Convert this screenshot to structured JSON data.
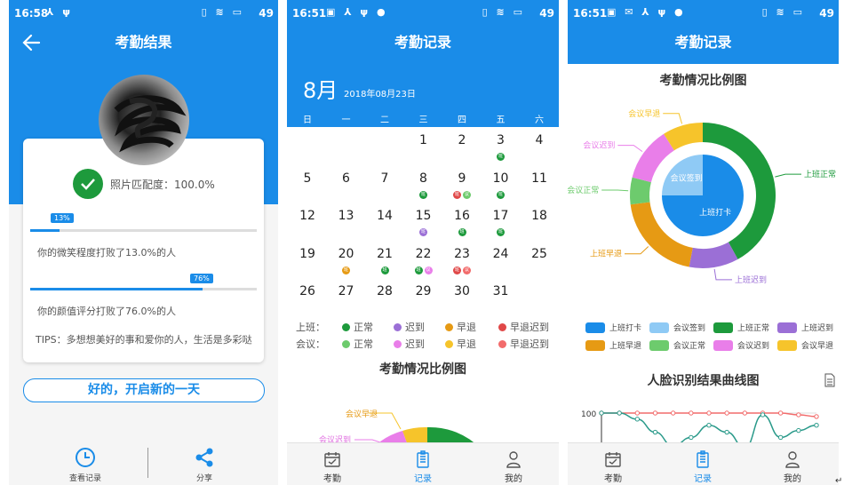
{
  "colors": {
    "primary": "#1a8ce8",
    "green": "#1d9a3c",
    "purple": "#9b6fd6",
    "orange": "#e69a14",
    "red": "#e04848",
    "light_green": "#6dcb6d",
    "pink": "#e97ee9",
    "yellow": "#f6c42b",
    "light_red": "#f26b6b",
    "light_blue": "#8fcaf5"
  },
  "screen1": {
    "status": {
      "time": "16:58",
      "battery": "49"
    },
    "title": "考勤结果",
    "match_text": "照片匹配度：100.0%",
    "smile": {
      "badge": "13%",
      "percent": 13,
      "text": "你的微笑程度打败了13.0%的人"
    },
    "looks": {
      "badge": "76%",
      "percent": 76,
      "text": "你的颜值评分打败了76.0%的人"
    },
    "tips": "TIPS：多想想美好的事和爱你的人，生活是多彩哒",
    "ok_button": "好的，开启新的一天",
    "actions": {
      "records": "查看记录",
      "share": "分享"
    }
  },
  "screen2": {
    "status": {
      "time": "16:51",
      "battery": "49"
    },
    "title": "考勤记录",
    "month": "8月",
    "date": "2018年08月23日",
    "weekdays": [
      "日",
      "一",
      "二",
      "三",
      "四",
      "五",
      "六"
    ],
    "days": [
      "1",
      "2",
      "3",
      "4",
      "5",
      "6",
      "7",
      "8",
      "9",
      "10",
      "11",
      "12",
      "13",
      "14",
      "15",
      "16",
      "17",
      "18",
      "19",
      "20",
      "21",
      "22",
      "23",
      "24",
      "25",
      "26",
      "27",
      "28",
      "29",
      "30",
      "31"
    ],
    "tags": [
      {
        "day": 3,
        "items": [
          {
            "label": "班",
            "color": "green"
          }
        ]
      },
      {
        "day": 8,
        "items": [
          {
            "label": "班",
            "color": "green"
          }
        ]
      },
      {
        "day": 9,
        "items": [
          {
            "label": "班",
            "color": "red"
          },
          {
            "label": "议",
            "color": "light_green"
          }
        ]
      },
      {
        "day": 10,
        "items": [
          {
            "label": "班",
            "color": "green"
          }
        ]
      },
      {
        "day": 15,
        "items": [
          {
            "label": "班",
            "color": "purple"
          }
        ]
      },
      {
        "day": 16,
        "items": [
          {
            "label": "班",
            "color": "green"
          }
        ]
      },
      {
        "day": 17,
        "items": [
          {
            "label": "班",
            "color": "green"
          }
        ]
      },
      {
        "day": 20,
        "items": [
          {
            "label": "班",
            "color": "orange"
          }
        ]
      },
      {
        "day": 21,
        "items": [
          {
            "label": "班",
            "color": "green"
          }
        ]
      },
      {
        "day": 22,
        "items": [
          {
            "label": "班",
            "color": "green"
          },
          {
            "label": "议",
            "color": "pink"
          }
        ]
      },
      {
        "day": 23,
        "items": [
          {
            "label": "班",
            "color": "red"
          },
          {
            "label": "议",
            "color": "light_red"
          }
        ]
      }
    ],
    "legend": {
      "work_label": "上班：",
      "meeting_label": "会议：",
      "work": [
        {
          "label": "正常",
          "color": "green"
        },
        {
          "label": "迟到",
          "color": "purple"
        },
        {
          "label": "早退",
          "color": "orange"
        },
        {
          "label": "早退迟到",
          "color": "red"
        }
      ],
      "meeting": [
        {
          "label": "正常",
          "color": "light_green"
        },
        {
          "label": "迟到",
          "color": "pink"
        },
        {
          "label": "早退",
          "color": "yellow"
        },
        {
          "label": "早退迟到",
          "color": "light_red"
        }
      ]
    },
    "chart_title": "考勤情况比例图",
    "chart_labels": {
      "early": "会议早退",
      "late": "会议迟到"
    },
    "tabs": [
      "考勤",
      "记录",
      "我的"
    ]
  },
  "screen3": {
    "status": {
      "time": "16:51",
      "battery": "49"
    },
    "title": "考勤记录",
    "chart_title": "考勤情况比例图",
    "line_title": "人脸识别结果曲线图",
    "tabs": [
      "考勤",
      "记录",
      "我的"
    ]
  },
  "chart_data": [
    {
      "type": "pie",
      "title": "考勤情况比例图",
      "inner": [
        {
          "name": "会议签到",
          "value": 25,
          "color": "light_blue"
        },
        {
          "name": "上班打卡",
          "value": 75,
          "color": "primary"
        }
      ],
      "outer": [
        {
          "name": "上班正常",
          "value": 42,
          "color": "green"
        },
        {
          "name": "上班迟到",
          "value": 11,
          "color": "purple"
        },
        {
          "name": "上班早退",
          "value": 20,
          "color": "orange"
        },
        {
          "name": "会议正常",
          "value": 6,
          "color": "light_green"
        },
        {
          "name": "会议迟到",
          "value": 12,
          "color": "pink"
        },
        {
          "name": "会议早退",
          "value": 9,
          "color": "yellow"
        }
      ],
      "legend": [
        {
          "name": "上班打卡",
          "color": "primary"
        },
        {
          "name": "会议签到",
          "color": "light_blue"
        },
        {
          "name": "上班正常",
          "color": "green"
        },
        {
          "name": "上班迟到",
          "color": "purple"
        },
        {
          "name": "上班早退",
          "color": "orange"
        },
        {
          "name": "会议正常",
          "color": "light_green"
        },
        {
          "name": "会议迟到",
          "color": "pink"
        },
        {
          "name": "会议早退",
          "color": "yellow"
        }
      ]
    },
    {
      "type": "line",
      "title": "人脸识别结果曲线图",
      "y_tick": "100",
      "series": [
        {
          "color": "light_red",
          "values": [
            100,
            100,
            100,
            100,
            100,
            100,
            100,
            100,
            100,
            100,
            100,
            98,
            96
          ]
        },
        {
          "color": "teal",
          "values": [
            100,
            100,
            93,
            78,
            62,
            72,
            86,
            78,
            60,
            98,
            72,
            80,
            86
          ]
        }
      ]
    }
  ]
}
